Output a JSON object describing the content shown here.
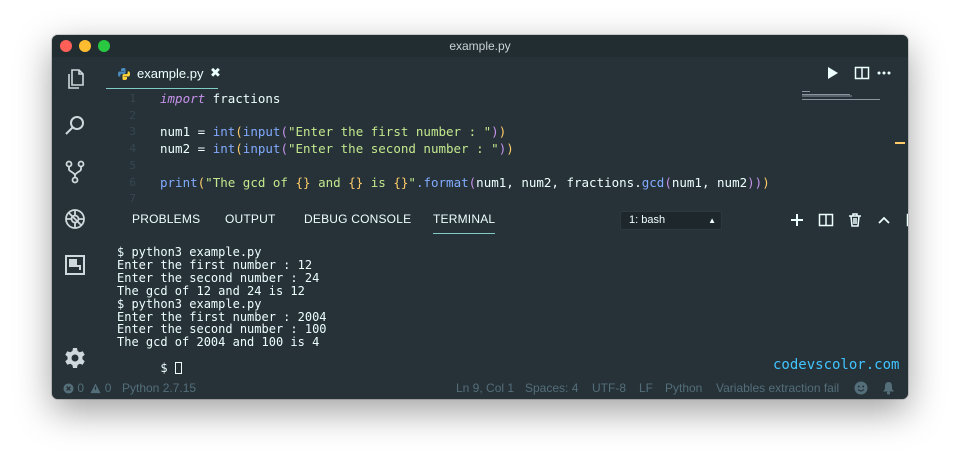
{
  "window": {
    "title": "example.py"
  },
  "tab": {
    "label": "example.py",
    "close": "✖"
  },
  "editor": {
    "lines": [
      {
        "num": "1",
        "tokens": [
          {
            "t": "import",
            "c": "kw"
          },
          {
            "t": " fractions",
            "c": ""
          }
        ]
      },
      {
        "num": "2",
        "tokens": []
      },
      {
        "num": "3",
        "tokens": [
          {
            "t": "num1 = ",
            "c": ""
          },
          {
            "t": "int",
            "c": "fn"
          },
          {
            "t": "(",
            "c": "br1"
          },
          {
            "t": "input",
            "c": "fn"
          },
          {
            "t": "(",
            "c": "br2"
          },
          {
            "t": "\"Enter the first number : \"",
            "c": "str"
          },
          {
            "t": ")",
            "c": "br2"
          },
          {
            "t": ")",
            "c": "br1"
          }
        ]
      },
      {
        "num": "4",
        "tokens": [
          {
            "t": "num2 = ",
            "c": ""
          },
          {
            "t": "int",
            "c": "fn"
          },
          {
            "t": "(",
            "c": "br1"
          },
          {
            "t": "input",
            "c": "fn"
          },
          {
            "t": "(",
            "c": "br2"
          },
          {
            "t": "\"Enter the second number : \"",
            "c": "str"
          },
          {
            "t": ")",
            "c": "br2"
          },
          {
            "t": ")",
            "c": "br1"
          }
        ]
      },
      {
        "num": "5",
        "tokens": []
      },
      {
        "num": "6",
        "tokens": [
          {
            "t": "print",
            "c": "fn"
          },
          {
            "t": "(",
            "c": "br1"
          },
          {
            "t": "\"The gcd of ",
            "c": "str"
          },
          {
            "t": "{}",
            "c": "br1"
          },
          {
            "t": " and ",
            "c": "str"
          },
          {
            "t": "{}",
            "c": "br1"
          },
          {
            "t": " is ",
            "c": "str"
          },
          {
            "t": "{}",
            "c": "br1"
          },
          {
            "t": "\"",
            "c": "str"
          },
          {
            "t": ".format",
            "c": "fn"
          },
          {
            "t": "(",
            "c": "br2"
          },
          {
            "t": "num1, num2, fractions.",
            "c": ""
          },
          {
            "t": "gcd",
            "c": "fn"
          },
          {
            "t": "(",
            "c": "br2"
          },
          {
            "t": "num1, num2",
            "c": ""
          },
          {
            "t": ")",
            "c": "br2"
          },
          {
            "t": ")",
            "c": "br2"
          },
          {
            "t": ")",
            "c": "br1"
          }
        ]
      },
      {
        "num": "7",
        "tokens": []
      }
    ]
  },
  "panel": {
    "tabs": [
      {
        "label": "PROBLEMS",
        "active": false
      },
      {
        "label": "OUTPUT",
        "active": false
      },
      {
        "label": "DEBUG CONSOLE",
        "active": false
      },
      {
        "label": "TERMINAL",
        "active": true
      }
    ],
    "terminal_select": "1: bash"
  },
  "terminal": {
    "lines": [
      "$ python3 example.py",
      "Enter the first number : 12",
      "Enter the second number : 24",
      "The gcd of 12 and 24 is 12",
      "$ python3 example.py",
      "Enter the first number : 2004",
      "Enter the second number : 100",
      "The gcd of 2004 and 100 is 4"
    ],
    "prompt": "$ "
  },
  "watermark": "codevscolor.com",
  "status": {
    "errors": "0",
    "warnings": "0",
    "interpreter": "Python 2.7.15",
    "position": "Ln 9, Col 1",
    "spaces": "Spaces: 4",
    "encoding": "UTF-8",
    "eol": "LF",
    "language": "Python",
    "message": "Variables extraction fail"
  },
  "colors": {
    "background": "#263238",
    "accent": "#80cbc4",
    "keyword": "#c792ea",
    "function": "#82aaff",
    "string": "#c3e88d",
    "bracket": "#ffcb6b",
    "watermark": "#40c4ff"
  }
}
